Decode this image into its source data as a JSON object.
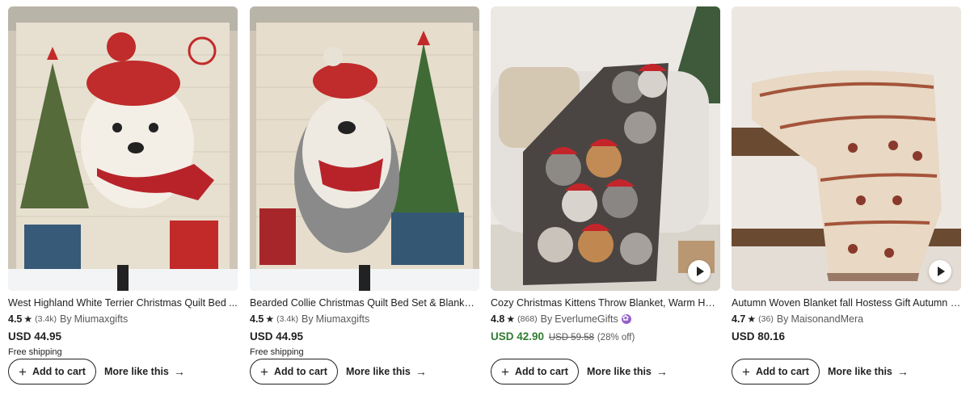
{
  "listings": [
    {
      "title": "West Highland White Terrier Christmas Quilt Bed ...",
      "rating": "4.5",
      "review_count": "(3.4k)",
      "by_label": "By",
      "shop": "Miumaxgifts",
      "price": "USD 44.95",
      "original_price": "",
      "discount": "",
      "shipping": "Free shipping",
      "has_video": false,
      "star_seller": false
    },
    {
      "title": "Bearded Collie Christmas Quilt Bed Set & Blanket ...",
      "rating": "4.5",
      "review_count": "(3.4k)",
      "by_label": "By",
      "shop": "Miumaxgifts",
      "price": "USD 44.95",
      "original_price": "",
      "discount": "",
      "shipping": "Free shipping",
      "has_video": false,
      "star_seller": false
    },
    {
      "title": "Cozy Christmas Kittens Throw Blanket, Warm Holi...",
      "rating": "4.8",
      "review_count": "(868)",
      "by_label": "By",
      "shop": "EverlumeGifts",
      "price": "USD 42.90",
      "original_price": "USD 59.58",
      "discount": "(28% off)",
      "shipping": "",
      "has_video": true,
      "star_seller": true
    },
    {
      "title": "Autumn Woven Blanket fall Hostess Gift Autumn H...",
      "rating": "4.7",
      "review_count": "(36)",
      "by_label": "By",
      "shop": "MaisonandMera",
      "price": "USD 80.16",
      "original_price": "",
      "discount": "",
      "shipping": "",
      "has_video": true,
      "star_seller": false
    }
  ],
  "actions": {
    "add_to_cart_label": "Add to cart",
    "more_like_this_label": "More like this"
  },
  "icons": {
    "star": "star-icon",
    "plus": "plus-icon",
    "arrow": "arrow-right-icon",
    "play": "play-icon",
    "star_seller": "star-seller-badge-icon"
  },
  "colors": {
    "sale_price": "#2f7d32",
    "star_seller_badge": "#9560c9",
    "text": "#222222",
    "muted": "#595959"
  }
}
